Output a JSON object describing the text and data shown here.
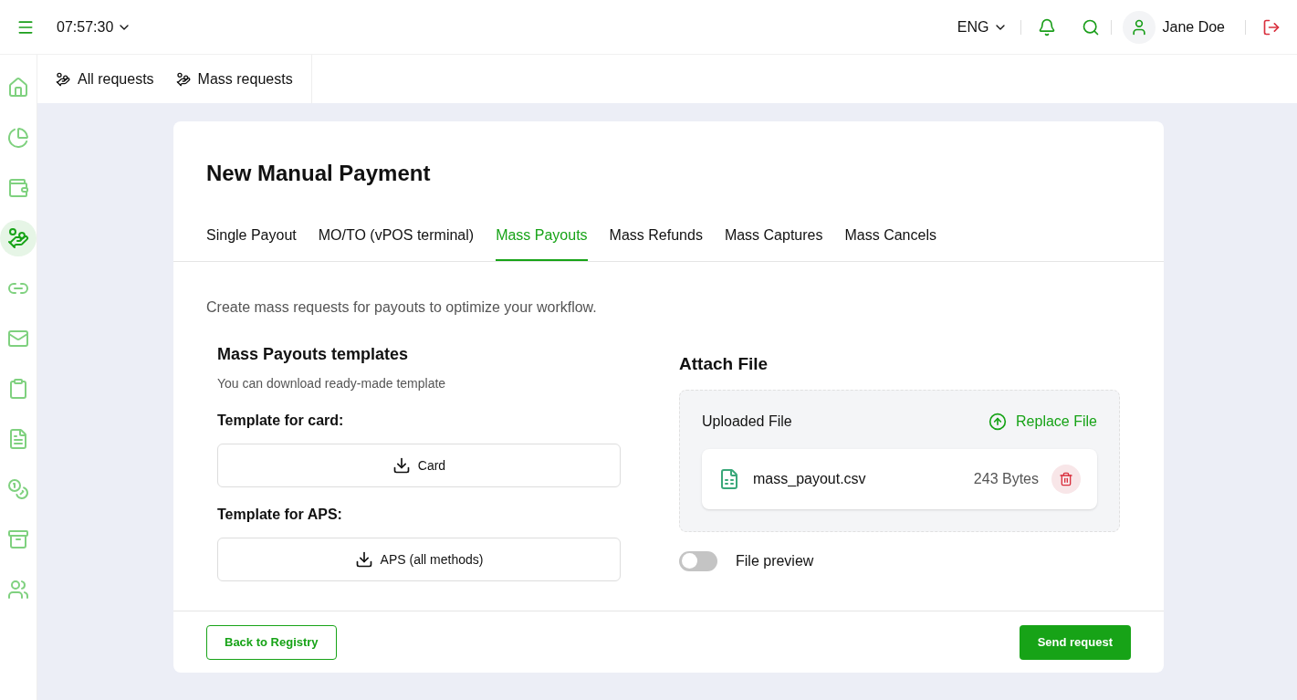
{
  "header": {
    "time": "07:57:30",
    "language": "ENG",
    "user": "Jane Doe"
  },
  "sidebar": {
    "items": [
      {
        "selected": false
      },
      {
        "selected": false
      },
      {
        "selected": false
      },
      {
        "selected": true
      },
      {
        "selected": false
      },
      {
        "selected": false
      },
      {
        "selected": false
      },
      {
        "selected": false
      },
      {
        "selected": false
      },
      {
        "selected": false
      },
      {
        "selected": false
      }
    ]
  },
  "subnav": [
    {
      "label": "All requests"
    },
    {
      "label": "Mass requests"
    }
  ],
  "title": "New Manual Payment",
  "tabs": [
    {
      "label": "Single Payout",
      "selected": false
    },
    {
      "label": "MO/TO (vPOS terminal)",
      "selected": false
    },
    {
      "label": "Mass Payouts",
      "selected": true
    },
    {
      "label": "Mass Refunds",
      "selected": false
    },
    {
      "label": "Mass Captures",
      "selected": false
    },
    {
      "label": "Mass Cancels",
      "selected": false
    }
  ],
  "description": "Create mass requests for payouts to optimize your workflow.",
  "templates": {
    "heading": "Mass Payouts templates",
    "subtitle": "You can download ready-made template",
    "groups": [
      {
        "label": "Template for card:",
        "button": "Card"
      },
      {
        "label": "Template for APS:",
        "button": "APS (all methods)"
      }
    ]
  },
  "attach": {
    "heading": "Attach File",
    "uploaded_label": "Uploaded File",
    "replace": "Replace File",
    "file": {
      "name": "mass_payout.csv",
      "size": "243 Bytes"
    },
    "preview": {
      "label": "File preview",
      "on": false
    }
  },
  "footer": {
    "back": "Back to Registry",
    "send": "Send request"
  }
}
